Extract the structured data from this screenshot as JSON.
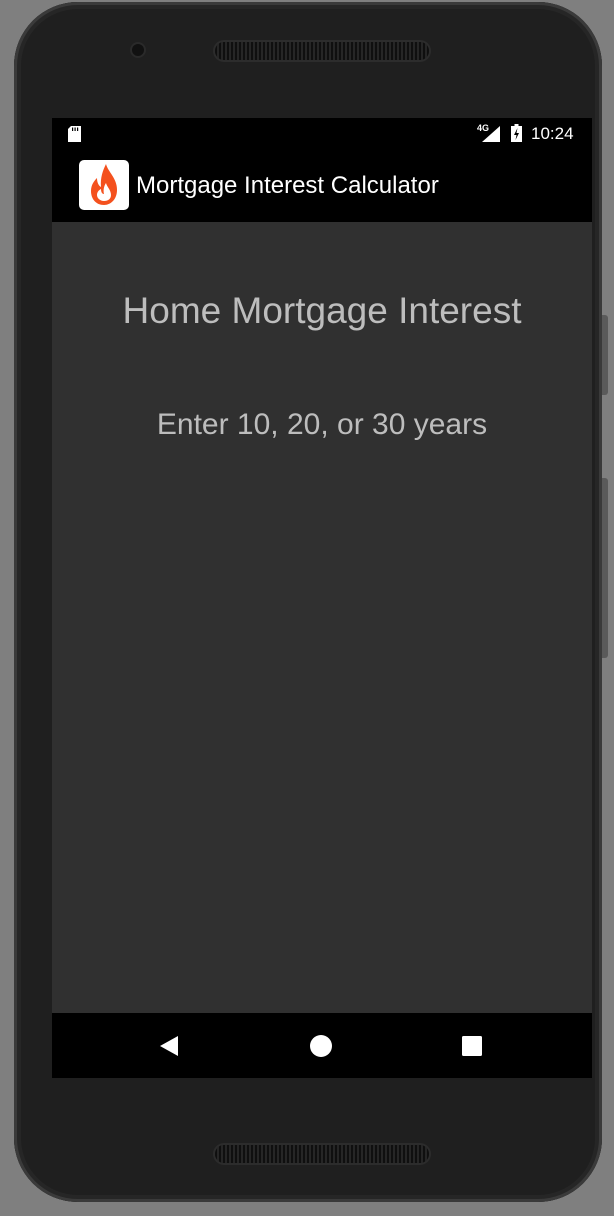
{
  "status_bar": {
    "network_type": "4G",
    "time": "10:24",
    "icons": [
      "sd-card-icon",
      "signal-icon",
      "battery-charging-icon"
    ]
  },
  "app_bar": {
    "title": "Mortgage Interest Calculator",
    "icon": "flame-logo-icon",
    "brand_color": "#f4511e"
  },
  "main": {
    "heading": "Home Mortgage Interest",
    "prompt": "Enter 10, 20, or 30 years"
  },
  "nav_bar": {
    "buttons": [
      "back-icon",
      "home-icon",
      "recents-icon"
    ]
  },
  "colors": {
    "screen_background": "#303030",
    "bar_background": "#000000",
    "text": "#bdbdbd"
  }
}
